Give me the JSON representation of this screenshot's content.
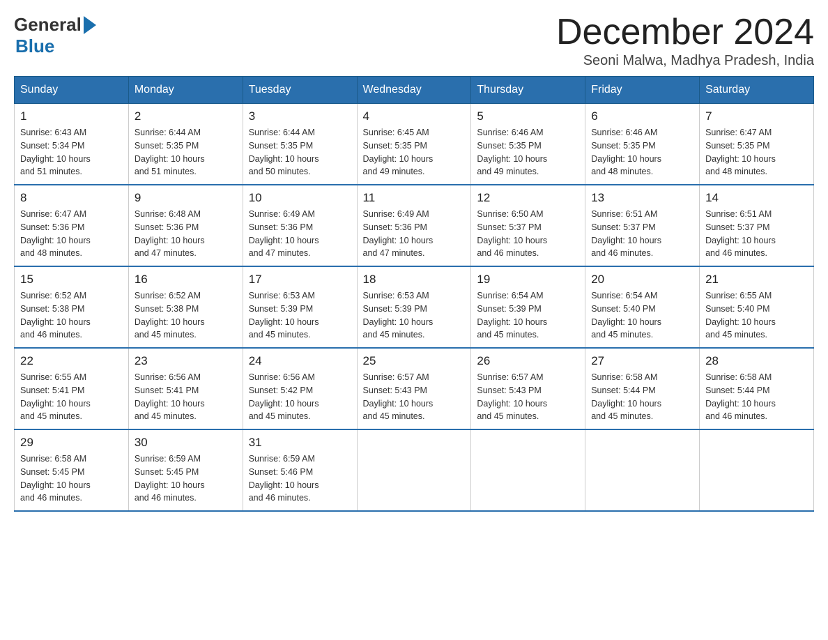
{
  "header": {
    "logo_general": "General",
    "logo_blue": "Blue",
    "month_title": "December 2024",
    "location": "Seoni Malwa, Madhya Pradesh, India"
  },
  "days_of_week": [
    "Sunday",
    "Monday",
    "Tuesday",
    "Wednesday",
    "Thursday",
    "Friday",
    "Saturday"
  ],
  "weeks": [
    [
      {
        "day": "1",
        "sunrise": "6:43 AM",
        "sunset": "5:34 PM",
        "daylight": "10 hours and 51 minutes."
      },
      {
        "day": "2",
        "sunrise": "6:44 AM",
        "sunset": "5:35 PM",
        "daylight": "10 hours and 51 minutes."
      },
      {
        "day": "3",
        "sunrise": "6:44 AM",
        "sunset": "5:35 PM",
        "daylight": "10 hours and 50 minutes."
      },
      {
        "day": "4",
        "sunrise": "6:45 AM",
        "sunset": "5:35 PM",
        "daylight": "10 hours and 49 minutes."
      },
      {
        "day": "5",
        "sunrise": "6:46 AM",
        "sunset": "5:35 PM",
        "daylight": "10 hours and 49 minutes."
      },
      {
        "day": "6",
        "sunrise": "6:46 AM",
        "sunset": "5:35 PM",
        "daylight": "10 hours and 48 minutes."
      },
      {
        "day": "7",
        "sunrise": "6:47 AM",
        "sunset": "5:35 PM",
        "daylight": "10 hours and 48 minutes."
      }
    ],
    [
      {
        "day": "8",
        "sunrise": "6:47 AM",
        "sunset": "5:36 PM",
        "daylight": "10 hours and 48 minutes."
      },
      {
        "day": "9",
        "sunrise": "6:48 AM",
        "sunset": "5:36 PM",
        "daylight": "10 hours and 47 minutes."
      },
      {
        "day": "10",
        "sunrise": "6:49 AM",
        "sunset": "5:36 PM",
        "daylight": "10 hours and 47 minutes."
      },
      {
        "day": "11",
        "sunrise": "6:49 AM",
        "sunset": "5:36 PM",
        "daylight": "10 hours and 47 minutes."
      },
      {
        "day": "12",
        "sunrise": "6:50 AM",
        "sunset": "5:37 PM",
        "daylight": "10 hours and 46 minutes."
      },
      {
        "day": "13",
        "sunrise": "6:51 AM",
        "sunset": "5:37 PM",
        "daylight": "10 hours and 46 minutes."
      },
      {
        "day": "14",
        "sunrise": "6:51 AM",
        "sunset": "5:37 PM",
        "daylight": "10 hours and 46 minutes."
      }
    ],
    [
      {
        "day": "15",
        "sunrise": "6:52 AM",
        "sunset": "5:38 PM",
        "daylight": "10 hours and 46 minutes."
      },
      {
        "day": "16",
        "sunrise": "6:52 AM",
        "sunset": "5:38 PM",
        "daylight": "10 hours and 45 minutes."
      },
      {
        "day": "17",
        "sunrise": "6:53 AM",
        "sunset": "5:39 PM",
        "daylight": "10 hours and 45 minutes."
      },
      {
        "day": "18",
        "sunrise": "6:53 AM",
        "sunset": "5:39 PM",
        "daylight": "10 hours and 45 minutes."
      },
      {
        "day": "19",
        "sunrise": "6:54 AM",
        "sunset": "5:39 PM",
        "daylight": "10 hours and 45 minutes."
      },
      {
        "day": "20",
        "sunrise": "6:54 AM",
        "sunset": "5:40 PM",
        "daylight": "10 hours and 45 minutes."
      },
      {
        "day": "21",
        "sunrise": "6:55 AM",
        "sunset": "5:40 PM",
        "daylight": "10 hours and 45 minutes."
      }
    ],
    [
      {
        "day": "22",
        "sunrise": "6:55 AM",
        "sunset": "5:41 PM",
        "daylight": "10 hours and 45 minutes."
      },
      {
        "day": "23",
        "sunrise": "6:56 AM",
        "sunset": "5:41 PM",
        "daylight": "10 hours and 45 minutes."
      },
      {
        "day": "24",
        "sunrise": "6:56 AM",
        "sunset": "5:42 PM",
        "daylight": "10 hours and 45 minutes."
      },
      {
        "day": "25",
        "sunrise": "6:57 AM",
        "sunset": "5:43 PM",
        "daylight": "10 hours and 45 minutes."
      },
      {
        "day": "26",
        "sunrise": "6:57 AM",
        "sunset": "5:43 PM",
        "daylight": "10 hours and 45 minutes."
      },
      {
        "day": "27",
        "sunrise": "6:58 AM",
        "sunset": "5:44 PM",
        "daylight": "10 hours and 45 minutes."
      },
      {
        "day": "28",
        "sunrise": "6:58 AM",
        "sunset": "5:44 PM",
        "daylight": "10 hours and 46 minutes."
      }
    ],
    [
      {
        "day": "29",
        "sunrise": "6:58 AM",
        "sunset": "5:45 PM",
        "daylight": "10 hours and 46 minutes."
      },
      {
        "day": "30",
        "sunrise": "6:59 AM",
        "sunset": "5:45 PM",
        "daylight": "10 hours and 46 minutes."
      },
      {
        "day": "31",
        "sunrise": "6:59 AM",
        "sunset": "5:46 PM",
        "daylight": "10 hours and 46 minutes."
      },
      null,
      null,
      null,
      null
    ]
  ],
  "labels": {
    "sunrise": "Sunrise:",
    "sunset": "Sunset:",
    "daylight": "Daylight:"
  }
}
